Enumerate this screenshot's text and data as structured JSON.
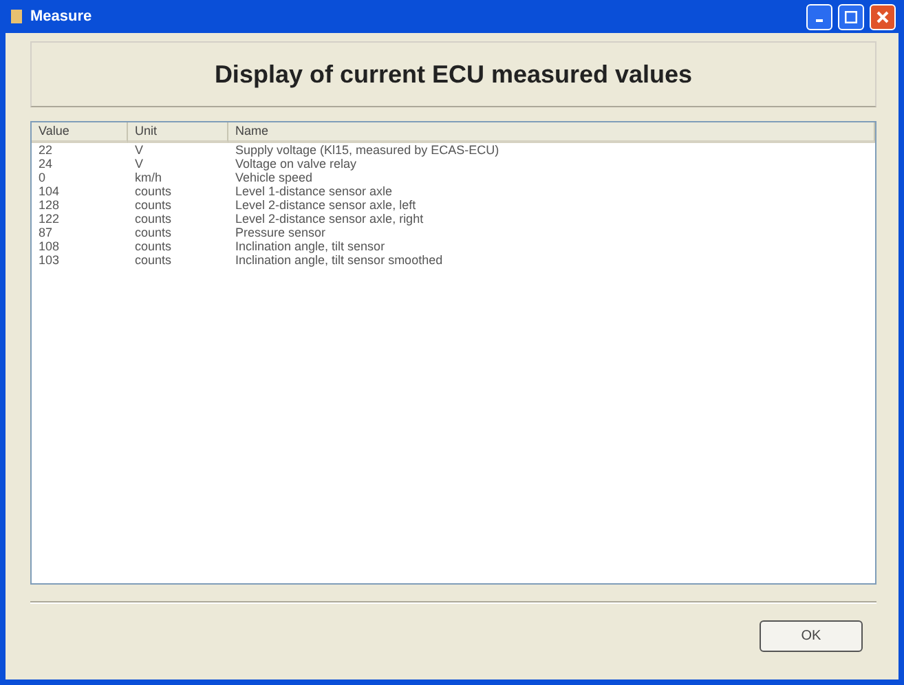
{
  "window": {
    "title": "Measure"
  },
  "header": "Display of current ECU measured values",
  "table": {
    "columns": [
      "Value",
      "Unit",
      "Name"
    ],
    "rows": [
      [
        "22",
        "V",
        "Supply voltage (Kl15, measured by ECAS-ECU)"
      ],
      [
        "24",
        "V",
        "Voltage on valve relay"
      ],
      [
        "0",
        "km/h",
        "Vehicle speed"
      ],
      [
        "104",
        "counts",
        "Level 1-distance sensor axle"
      ],
      [
        "128",
        "counts",
        "Level 2-distance sensor axle, left"
      ],
      [
        "122",
        "counts",
        "Level 2-distance sensor axle, right"
      ],
      [
        "87",
        "counts",
        "Pressure sensor"
      ],
      [
        "108",
        "counts",
        "Inclination angle, tilt sensor"
      ],
      [
        "103",
        "counts",
        "Inclination angle, tilt sensor smoothed"
      ]
    ]
  },
  "buttons": [
    "OK"
  ]
}
